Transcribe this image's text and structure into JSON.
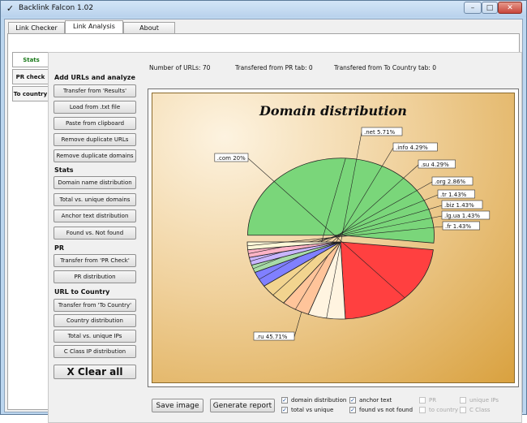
{
  "window": {
    "title": "Backlink Falcon 1.02",
    "min_label": "–",
    "max_label": "□",
    "close_label": "✕"
  },
  "tabs": [
    "Link Checker",
    "Link Analysis",
    "About"
  ],
  "side_tabs": [
    "Stats",
    "PR check",
    "To country"
  ],
  "stats": {
    "urls": "Number of URLs: 70",
    "pr": "Transfered from PR tab: 0",
    "country": "Transfered from To Country tab: 0"
  },
  "sections": {
    "add": "Add URLs and analyze",
    "stats": "Stats",
    "pr": "PR",
    "country": "URL to Country"
  },
  "buttons": {
    "transfer_results": "Transfer from 'Results'",
    "load_txt": "Load from .txt file",
    "paste": "Paste from clipboard",
    "remove_dup_urls": "Remove duplicate URLs",
    "remove_dup_domains": "Remove duplicate domains",
    "domain_dist": "Domain name distribution",
    "total_unique_domains": "Total vs. unique domains",
    "anchor_dist": "Anchor text distribution",
    "found_not_found": "Found vs. Not found",
    "transfer_pr": "Transfer from 'PR Check'",
    "pr_dist": "PR distribution",
    "transfer_country": "Transfer from 'To Country'",
    "country_dist": "Country distribution",
    "total_unique_ips": "Total vs. unique IPs",
    "cclass_dist": "C Class IP distribution",
    "clear_all": "X Clear all",
    "save_image": "Save image",
    "generate_report": "Generate report"
  },
  "checkboxes": [
    {
      "label": "domain distribution",
      "checked": true,
      "enabled": true
    },
    {
      "label": "total vs unique",
      "checked": true,
      "enabled": true
    },
    {
      "label": "anchor text",
      "checked": true,
      "enabled": true
    },
    {
      "label": "found vs not found",
      "checked": true,
      "enabled": true
    },
    {
      "label": "PR",
      "checked": false,
      "enabled": false
    },
    {
      "label": "to country",
      "checked": false,
      "enabled": false
    },
    {
      "label": "unique IPs",
      "checked": false,
      "enabled": false
    },
    {
      "label": "C Class",
      "checked": false,
      "enabled": false
    }
  ],
  "chart_data": {
    "type": "pie",
    "title": "Domain distribution",
    "slices": [
      {
        "label": ".ru 45.71%",
        "value": 45.71,
        "color": "#7ad67a",
        "exploded": true
      },
      {
        "label": ".com 20%",
        "value": 20,
        "color": "#ff4040",
        "exploded": false
      },
      {
        "label": ".net 5.71%",
        "value": 5.71,
        "color": "#fff4e0",
        "exploded": false
      },
      {
        "label": ".info 4.29%",
        "value": 4.29,
        "color": "#ffc49a",
        "exploded": false
      },
      {
        "label": ".su 4.29%",
        "value": 4.29,
        "color": "#f2d48f",
        "exploded": false
      },
      {
        "label": ".org 2.86%",
        "value": 2.86,
        "color": "#8080ff",
        "exploded": false
      },
      {
        "label": ".tr 1.43%",
        "value": 1.43,
        "color": "#a8dca8",
        "exploded": false
      },
      {
        "label": ".biz 1.43%",
        "value": 1.43,
        "color": "#c9b5ff",
        "exploded": false
      },
      {
        "label": ".lg.ua 1.43%",
        "value": 1.43,
        "color": "#ffb3c6",
        "exploded": false
      },
      {
        "label": ".fr 1.43%",
        "value": 1.43,
        "color": "#fff8d8",
        "exploded": false
      }
    ]
  }
}
